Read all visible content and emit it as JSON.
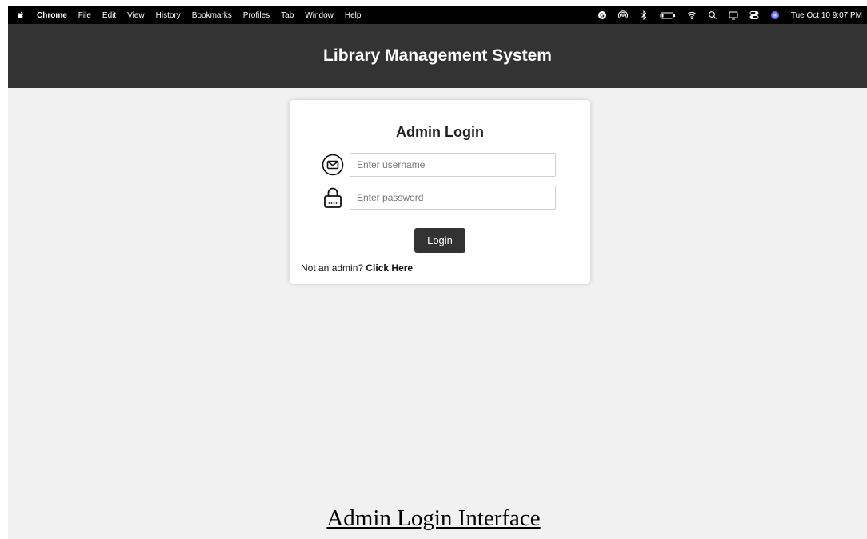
{
  "menubar": {
    "app_name": "Chrome",
    "menus": [
      "File",
      "Edit",
      "View",
      "History",
      "Bookmarks",
      "Profiles",
      "Tab",
      "Window",
      "Help"
    ],
    "clock": "Tue Oct 10  9:07 PM",
    "status_icons": [
      "grammarly-icon",
      "airdrop-icon",
      "bluetooth-icon",
      "battery-icon",
      "wifi-icon",
      "search-icon",
      "screen-mirroring-icon",
      "control-center-icon",
      "siri-icon"
    ]
  },
  "header": {
    "title": "Library Management System"
  },
  "login": {
    "title": "Admin Login",
    "username_placeholder": "Enter username",
    "password_placeholder": "Enter password",
    "button_label": "Login",
    "not_admin_text": "Not an admin?",
    "click_here": "Click Here"
  },
  "caption": "Admin Login Interface",
  "colors": {
    "header_bg": "#333333",
    "page_bg": "#f1f1f1",
    "button_bg": "#333333"
  }
}
